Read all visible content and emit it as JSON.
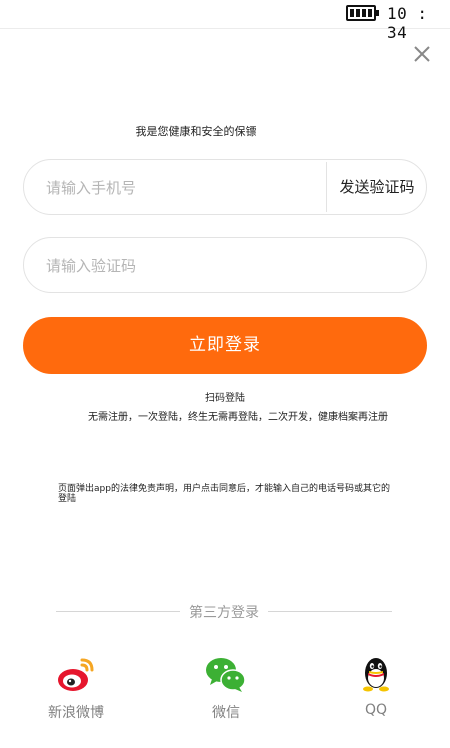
{
  "status_bar": {
    "time": "10 : 34",
    "battery_icon": "battery-full-icon"
  },
  "close_icon": "close-icon",
  "slogan": "我是您健康和安全的保镖",
  "phone_input": {
    "placeholder": "请输入手机号",
    "value": ""
  },
  "send_code_label": "发送验证码",
  "code_input": {
    "placeholder": "请输入验证码",
    "value": ""
  },
  "login_button_label": "立即登录",
  "qr_login_label": "扫码登陆",
  "tagline": "无需注册，一次登陆，终生无需再登陆，二次开发，健康档案再注册",
  "disclaimer": "页面弹出app的法律免责声明，用户点击同意后，才能输入自己的电话号码或其它的登陆",
  "third_party": {
    "heading": "第三方登录",
    "items": [
      {
        "label": "新浪微博",
        "icon": "weibo-icon"
      },
      {
        "label": "微信",
        "icon": "wechat-icon"
      },
      {
        "label": "QQ",
        "icon": "qq-icon"
      }
    ]
  },
  "colors": {
    "accent": "#ff6a0d",
    "weibo_red": "#e6162d",
    "wechat_green": "#3cb034"
  }
}
